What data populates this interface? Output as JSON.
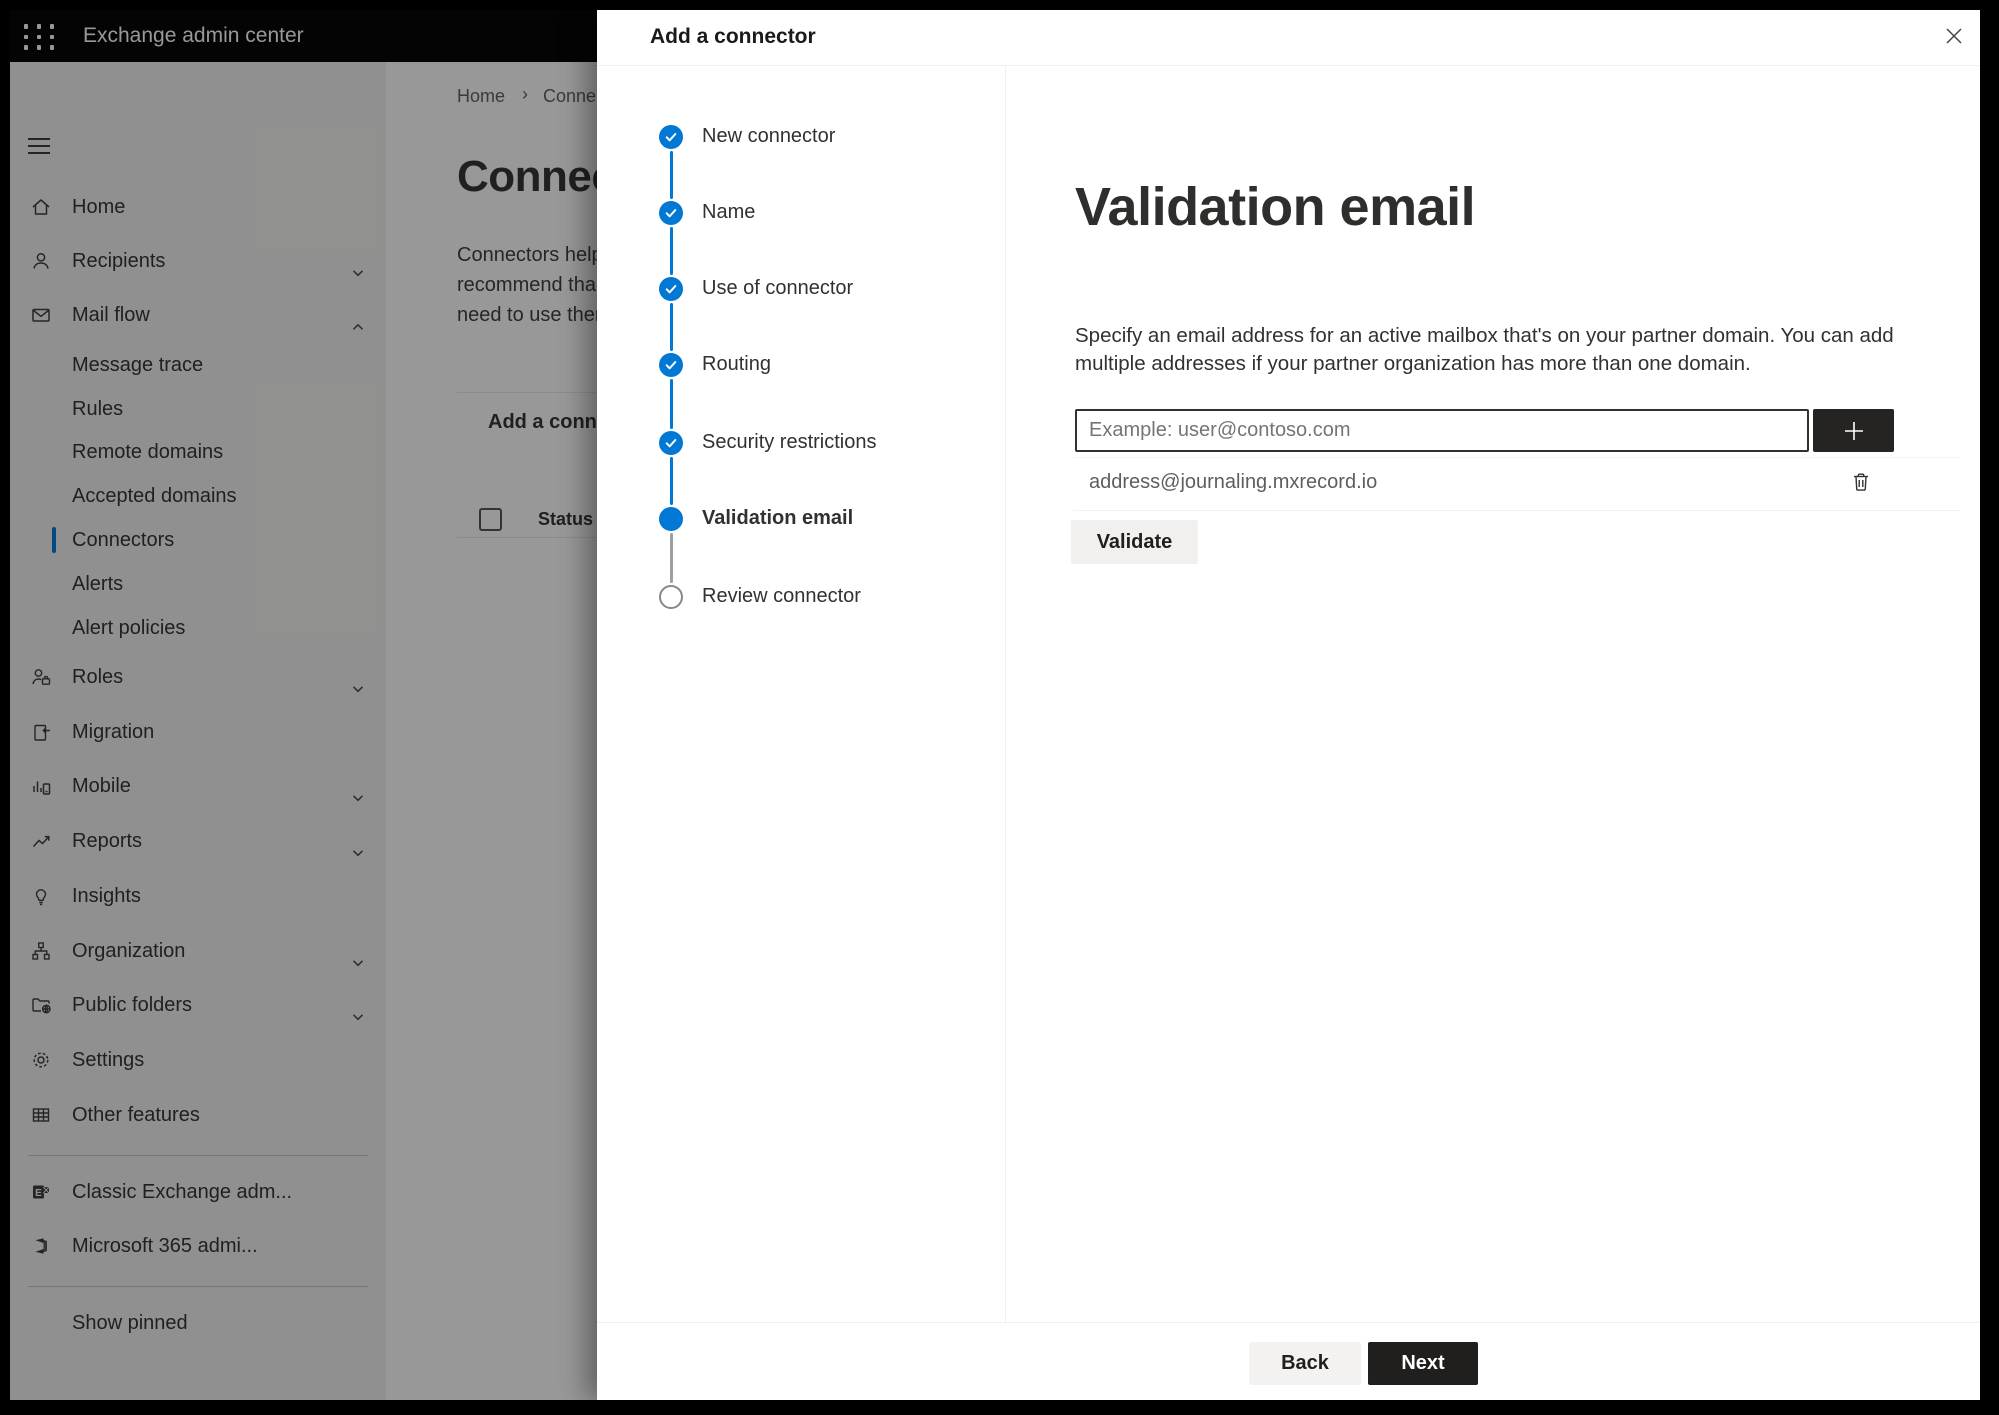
{
  "app": {
    "header": {
      "title": "Exchange admin center"
    },
    "sidebar": {
      "items": [
        {
          "label": "Home",
          "icon": "home-icon"
        },
        {
          "label": "Recipients",
          "icon": "person-icon",
          "chevron": "down"
        },
        {
          "label": "Mail flow",
          "icon": "mail-icon",
          "chevron": "up"
        },
        {
          "label": "Message trace",
          "indent": true
        },
        {
          "label": "Rules",
          "indent": true
        },
        {
          "label": "Remote domains",
          "indent": true
        },
        {
          "label": "Accepted domains",
          "indent": true
        },
        {
          "label": "Connectors",
          "indent": true,
          "selected": true
        },
        {
          "label": "Alerts",
          "indent": true
        },
        {
          "label": "Alert policies",
          "indent": true
        },
        {
          "label": "Roles",
          "icon": "roles-icon",
          "chevron": "down"
        },
        {
          "label": "Migration",
          "icon": "migration-icon"
        },
        {
          "label": "Mobile",
          "icon": "mobile-icon",
          "chevron": "down"
        },
        {
          "label": "Reports",
          "icon": "reports-icon",
          "chevron": "down"
        },
        {
          "label": "Insights",
          "icon": "lightbulb-icon"
        },
        {
          "label": "Organization",
          "icon": "organization-icon",
          "chevron": "down"
        },
        {
          "label": "Public folders",
          "icon": "public-folders-icon",
          "chevron": "down"
        },
        {
          "label": "Settings",
          "icon": "gear-icon"
        },
        {
          "label": "Other features",
          "icon": "grid-icon"
        }
      ],
      "footer_items": [
        {
          "label": "Classic Exchange adm...",
          "icon": "exchange-logo-icon"
        },
        {
          "label": "Microsoft 365 admi...",
          "icon": "microsoft365-logo-icon"
        }
      ],
      "show_pinned": {
        "label": "Show pinned",
        "icon": "ellipsis-icon"
      }
    },
    "page": {
      "breadcrumb": {
        "home": "Home",
        "separator": "›",
        "current": "Conne"
      },
      "title": "Connec",
      "description_lines": [
        {
          "text": "Connectors help"
        },
        {
          "text": "recommend tha"
        },
        {
          "text": "need to use ther"
        }
      ],
      "add_button_label": "Add a conn",
      "table": {
        "status_header": "Status"
      }
    }
  },
  "panel": {
    "title": "Add a connector",
    "steps": [
      {
        "label": "New connector",
        "state": "completed"
      },
      {
        "label": "Name",
        "state": "completed"
      },
      {
        "label": "Use of connector",
        "state": "completed"
      },
      {
        "label": "Routing",
        "state": "completed"
      },
      {
        "label": "Security restrictions",
        "state": "completed"
      },
      {
        "label": "Validation email",
        "state": "current"
      },
      {
        "label": "Review connector",
        "state": "upcoming"
      }
    ],
    "content": {
      "heading": "Validation email",
      "description_lines": [
        {
          "text": "Specify an email address for an active mailbox that's on your partner domain. You can add"
        },
        {
          "text": "multiple addresses if your partner organization has more than one domain."
        }
      ],
      "email_input": {
        "placeholder": "Example: user@contoso.com",
        "value": ""
      },
      "addresses": [
        {
          "email": "address@journaling.mxrecord.io"
        }
      ],
      "validate_button": "Validate"
    },
    "footer": {
      "back_button": "Back",
      "next_button": "Next"
    }
  },
  "colors": {
    "accent": "#0078d4",
    "header_bg": "#000000",
    "dark_button": "#201f1e",
    "plus_button": "#252423",
    "light_button": "#f3f2f1",
    "text_primary": "#323130",
    "text_secondary": "#605e5c"
  }
}
